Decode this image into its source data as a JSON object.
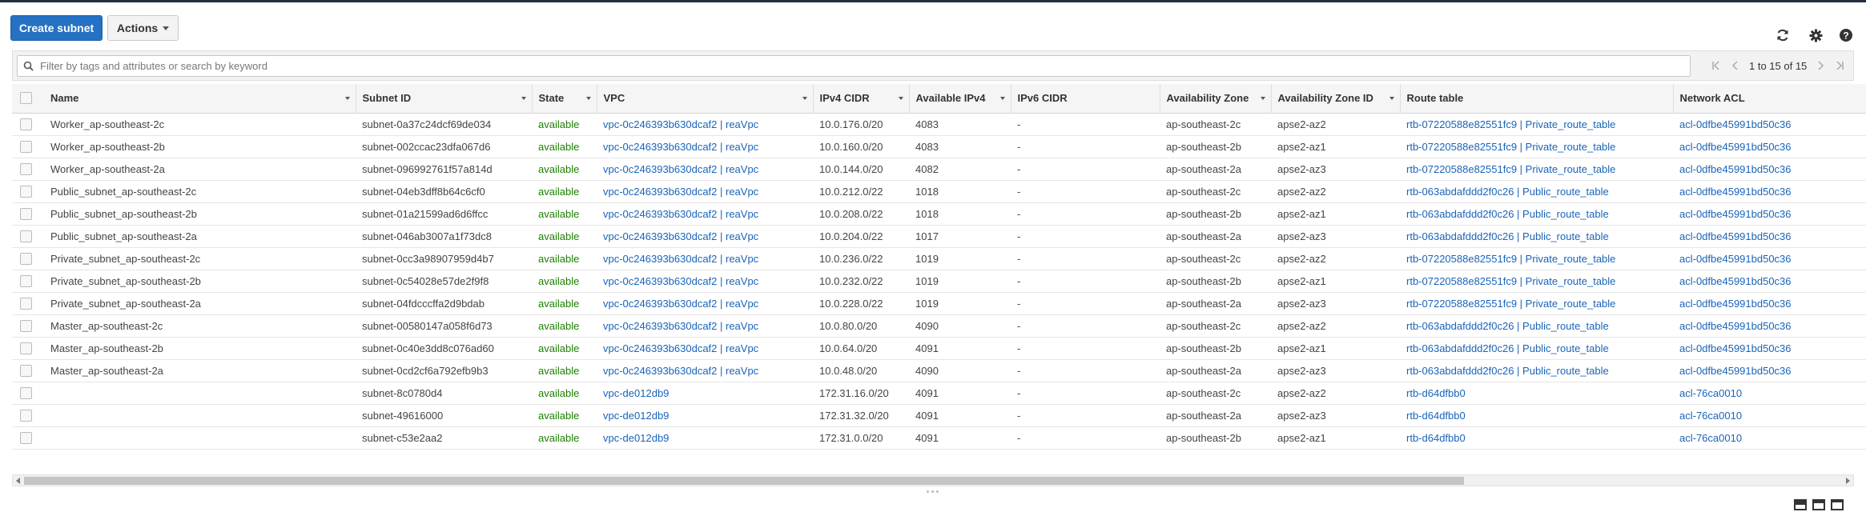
{
  "toolbar": {
    "create_label": "Create subnet",
    "actions_label": "Actions"
  },
  "icons": {
    "refresh": "refresh-icon",
    "settings": "gear-icon",
    "help": "help-icon"
  },
  "search": {
    "placeholder": "Filter by tags and attributes or search by keyword"
  },
  "pagination": {
    "text": "1 to 15 of 15"
  },
  "colors": {
    "primary": "#2571c4",
    "link": "#1a64b8",
    "available": "#1d8102",
    "topbar": "#232f3e"
  },
  "table": {
    "columns": [
      {
        "label": "Name",
        "sortable": true
      },
      {
        "label": "Subnet ID",
        "sortable": true
      },
      {
        "label": "State",
        "sortable": true
      },
      {
        "label": "VPC",
        "sortable": true
      },
      {
        "label": "IPv4 CIDR",
        "sortable": true
      },
      {
        "label": "Available IPv4",
        "sortable": true
      },
      {
        "label": "IPv6 CIDR",
        "sortable": false
      },
      {
        "label": "Availability Zone",
        "sortable": true
      },
      {
        "label": "Availability Zone ID",
        "sortable": true
      },
      {
        "label": "Route table",
        "sortable": false
      },
      {
        "label": "Network ACL",
        "sortable": false
      }
    ],
    "rows": [
      {
        "name": "Worker_ap-southeast-2c",
        "subnet_id": "subnet-0a37c24dcf69de034",
        "state": "available",
        "vpc": "vpc-0c246393b630dcaf2 | reaVpc",
        "ipv4": "10.0.176.0/20",
        "avail": "4083",
        "ipv6": "-",
        "az": "ap-southeast-2c",
        "az_id": "apse2-az2",
        "route": "rtb-07220588e82551fc9 | Private_route_table",
        "acl": "acl-0dfbe45991bd50c36"
      },
      {
        "name": "Worker_ap-southeast-2b",
        "subnet_id": "subnet-002ccac23dfa067d6",
        "state": "available",
        "vpc": "vpc-0c246393b630dcaf2 | reaVpc",
        "ipv4": "10.0.160.0/20",
        "avail": "4083",
        "ipv6": "-",
        "az": "ap-southeast-2b",
        "az_id": "apse2-az1",
        "route": "rtb-07220588e82551fc9 | Private_route_table",
        "acl": "acl-0dfbe45991bd50c36"
      },
      {
        "name": "Worker_ap-southeast-2a",
        "subnet_id": "subnet-096992761f57a814d",
        "state": "available",
        "vpc": "vpc-0c246393b630dcaf2 | reaVpc",
        "ipv4": "10.0.144.0/20",
        "avail": "4082",
        "ipv6": "-",
        "az": "ap-southeast-2a",
        "az_id": "apse2-az3",
        "route": "rtb-07220588e82551fc9 | Private_route_table",
        "acl": "acl-0dfbe45991bd50c36"
      },
      {
        "name": "Public_subnet_ap-southeast-2c",
        "subnet_id": "subnet-04eb3dff8b64c6cf0",
        "state": "available",
        "vpc": "vpc-0c246393b630dcaf2 | reaVpc",
        "ipv4": "10.0.212.0/22",
        "avail": "1018",
        "ipv6": "-",
        "az": "ap-southeast-2c",
        "az_id": "apse2-az2",
        "route": "rtb-063abdafddd2f0c26 | Public_route_table",
        "acl": "acl-0dfbe45991bd50c36"
      },
      {
        "name": "Public_subnet_ap-southeast-2b",
        "subnet_id": "subnet-01a21599ad6d6ffcc",
        "state": "available",
        "vpc": "vpc-0c246393b630dcaf2 | reaVpc",
        "ipv4": "10.0.208.0/22",
        "avail": "1018",
        "ipv6": "-",
        "az": "ap-southeast-2b",
        "az_id": "apse2-az1",
        "route": "rtb-063abdafddd2f0c26 | Public_route_table",
        "acl": "acl-0dfbe45991bd50c36"
      },
      {
        "name": "Public_subnet_ap-southeast-2a",
        "subnet_id": "subnet-046ab3007a1f73dc8",
        "state": "available",
        "vpc": "vpc-0c246393b630dcaf2 | reaVpc",
        "ipv4": "10.0.204.0/22",
        "avail": "1017",
        "ipv6": "-",
        "az": "ap-southeast-2a",
        "az_id": "apse2-az3",
        "route": "rtb-063abdafddd2f0c26 | Public_route_table",
        "acl": "acl-0dfbe45991bd50c36"
      },
      {
        "name": "Private_subnet_ap-southeast-2c",
        "subnet_id": "subnet-0cc3a98907959d4b7",
        "state": "available",
        "vpc": "vpc-0c246393b630dcaf2 | reaVpc",
        "ipv4": "10.0.236.0/22",
        "avail": "1019",
        "ipv6": "-",
        "az": "ap-southeast-2c",
        "az_id": "apse2-az2",
        "route": "rtb-07220588e82551fc9 | Private_route_table",
        "acl": "acl-0dfbe45991bd50c36"
      },
      {
        "name": "Private_subnet_ap-southeast-2b",
        "subnet_id": "subnet-0c54028e57de2f9f8",
        "state": "available",
        "vpc": "vpc-0c246393b630dcaf2 | reaVpc",
        "ipv4": "10.0.232.0/22",
        "avail": "1019",
        "ipv6": "-",
        "az": "ap-southeast-2b",
        "az_id": "apse2-az1",
        "route": "rtb-07220588e82551fc9 | Private_route_table",
        "acl": "acl-0dfbe45991bd50c36"
      },
      {
        "name": "Private_subnet_ap-southeast-2a",
        "subnet_id": "subnet-04fdcccffa2d9bdab",
        "state": "available",
        "vpc": "vpc-0c246393b630dcaf2 | reaVpc",
        "ipv4": "10.0.228.0/22",
        "avail": "1019",
        "ipv6": "-",
        "az": "ap-southeast-2a",
        "az_id": "apse2-az3",
        "route": "rtb-07220588e82551fc9 | Private_route_table",
        "acl": "acl-0dfbe45991bd50c36"
      },
      {
        "name": "Master_ap-southeast-2c",
        "subnet_id": "subnet-00580147a058f6d73",
        "state": "available",
        "vpc": "vpc-0c246393b630dcaf2 | reaVpc",
        "ipv4": "10.0.80.0/20",
        "avail": "4090",
        "ipv6": "-",
        "az": "ap-southeast-2c",
        "az_id": "apse2-az2",
        "route": "rtb-063abdafddd2f0c26 | Public_route_table",
        "acl": "acl-0dfbe45991bd50c36"
      },
      {
        "name": "Master_ap-southeast-2b",
        "subnet_id": "subnet-0c40e3dd8c076ad60",
        "state": "available",
        "vpc": "vpc-0c246393b630dcaf2 | reaVpc",
        "ipv4": "10.0.64.0/20",
        "avail": "4091",
        "ipv6": "-",
        "az": "ap-southeast-2b",
        "az_id": "apse2-az1",
        "route": "rtb-063abdafddd2f0c26 | Public_route_table",
        "acl": "acl-0dfbe45991bd50c36"
      },
      {
        "name": "Master_ap-southeast-2a",
        "subnet_id": "subnet-0cd2cf6a792efb9b3",
        "state": "available",
        "vpc": "vpc-0c246393b630dcaf2 | reaVpc",
        "ipv4": "10.0.48.0/20",
        "avail": "4090",
        "ipv6": "-",
        "az": "ap-southeast-2a",
        "az_id": "apse2-az3",
        "route": "rtb-063abdafddd2f0c26 | Public_route_table",
        "acl": "acl-0dfbe45991bd50c36"
      },
      {
        "name": "",
        "subnet_id": "subnet-8c0780d4",
        "state": "available",
        "vpc": "vpc-de012db9",
        "ipv4": "172.31.16.0/20",
        "avail": "4091",
        "ipv6": "-",
        "az": "ap-southeast-2c",
        "az_id": "apse2-az2",
        "route": "rtb-d64dfbb0",
        "acl": "acl-76ca0010"
      },
      {
        "name": "",
        "subnet_id": "subnet-49616000",
        "state": "available",
        "vpc": "vpc-de012db9",
        "ipv4": "172.31.32.0/20",
        "avail": "4091",
        "ipv6": "-",
        "az": "ap-southeast-2a",
        "az_id": "apse2-az3",
        "route": "rtb-d64dfbb0",
        "acl": "acl-76ca0010"
      },
      {
        "name": "",
        "subnet_id": "subnet-c53e2aa2",
        "state": "available",
        "vpc": "vpc-de012db9",
        "ipv4": "172.31.0.0/20",
        "avail": "4091",
        "ipv6": "-",
        "az": "ap-southeast-2b",
        "az_id": "apse2-az1",
        "route": "rtb-d64dfbb0",
        "acl": "acl-76ca0010"
      }
    ]
  }
}
